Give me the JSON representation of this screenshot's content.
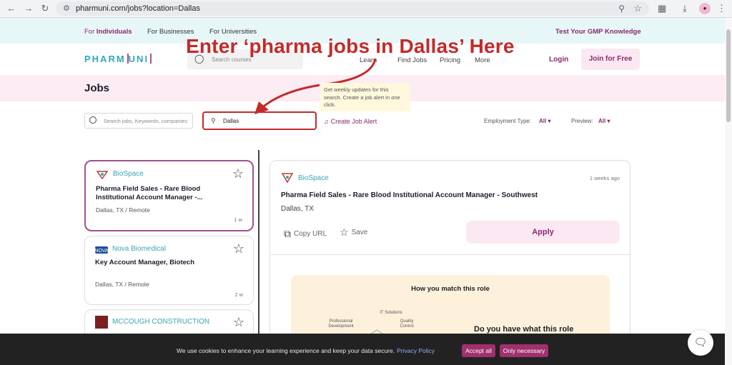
{
  "browser": {
    "url": "pharmuni.com/jobs?location=Dallas",
    "icons": [
      "back-icon",
      "forward-icon",
      "reload-icon",
      "zoom-icon",
      "star-icon",
      "extensions-icon",
      "download-icon",
      "menu-icon"
    ]
  },
  "topbar": {
    "for_label": "For",
    "individuals": "Individuals",
    "businesses": "For Businesses",
    "universities": "For Universities",
    "gmp_test": "Test Your GMP Knowledge"
  },
  "header": {
    "logo_left": "PHARM",
    "logo_right": "UNI",
    "search_placeholder": "Search courses",
    "menu": [
      "Learn",
      "Find Jobs",
      "Pricing",
      "More"
    ],
    "login": "Login",
    "join": "Join for Free"
  },
  "annotation": {
    "text": "Enter ‘pharma jobs in Dallas’ Here",
    "color": "#c42a2a"
  },
  "page": {
    "title": "Jobs",
    "tooltip": "Get weekly updates for this search. Create a job alert in one click."
  },
  "filters": {
    "search_placeholder": "Search jobs, Keywords, companies",
    "location": "Dallas",
    "create_alert": "Create Job Alert",
    "employment_type_label": "Employment Type:",
    "employment_type_value": "All",
    "preview_label": "Preview:",
    "preview_value": "All"
  },
  "jobs": [
    {
      "company": "BioSpace",
      "title": "Pharma Field Sales - Rare Blood Institutional Account Manager -...",
      "location": "Dallas, TX / Remote",
      "age": "1 w"
    },
    {
      "company": "Nova Biomedical",
      "title": "Key Account Manager, Biotech",
      "location": "Dallas, TX / Remote",
      "age": "2 w"
    },
    {
      "company": "MCCOUGH CONSTRUCTION",
      "title": "",
      "location": "",
      "age": ""
    }
  ],
  "detail": {
    "company": "BioSpace",
    "age": "1 weeks ago",
    "title": "Pharma Field Sales - Rare Blood Institutional Account Manager - Southwest",
    "location": "Dallas, TX",
    "copy_url": "Copy URL",
    "save": "Save",
    "apply": "Apply",
    "match_title": "How you match this role",
    "match_labels": [
      "IT Solutions",
      "Professional Development",
      "Quality Control"
    ],
    "match_question": "Do you have what this role"
  },
  "cookie": {
    "message": "We use cookies to enhance your learning experience and keep your data secure.",
    "policy": "Privacy Policy",
    "accept": "Accept all",
    "necessary": "Only necessary"
  },
  "colors": {
    "brand": "#8a2a6e",
    "teal": "#2fa9b8",
    "annotation": "#c42a2a"
  }
}
